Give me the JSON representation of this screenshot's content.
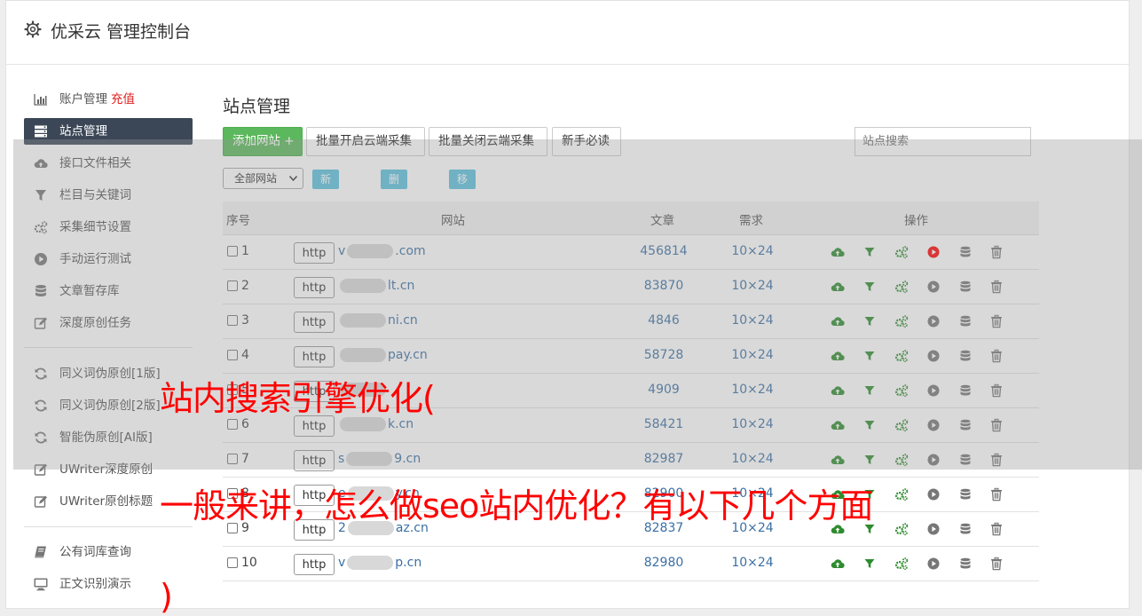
{
  "app": {
    "title": "优采云 管理控制台"
  },
  "sidebar": {
    "items": [
      {
        "label": "账户管理",
        "extra": "充值",
        "icon": "bar-chart-icon"
      },
      {
        "label": "站点管理",
        "icon": "server-icon",
        "active": true
      },
      {
        "label": "接口文件相关",
        "icon": "cloud-upload-icon"
      },
      {
        "label": "栏目与关键词",
        "icon": "filter-icon"
      },
      {
        "label": "采集细节设置",
        "icon": "gears-icon"
      },
      {
        "label": "手动运行测试",
        "icon": "play-circle-icon"
      },
      {
        "label": "文章暂存库",
        "icon": "database-icon"
      },
      {
        "label": "深度原创任务",
        "icon": "edit-icon"
      },
      {
        "label": "同义词伪原创[1版]",
        "icon": "refresh-icon"
      },
      {
        "label": "同义词伪原创[2版]",
        "icon": "refresh-icon"
      },
      {
        "label": "智能伪原创[AI版]",
        "icon": "refresh-icon"
      },
      {
        "label": "UWriter深度原创",
        "icon": "edit-icon"
      },
      {
        "label": "UWriter原创标题",
        "icon": "edit-icon"
      },
      {
        "label": "公有词库查询",
        "icon": "book-icon"
      },
      {
        "label": "正文识别演示",
        "icon": "monitor-icon"
      }
    ]
  },
  "main": {
    "title": "站点管理",
    "toolbar": {
      "add_site": "添加网站 +",
      "batch_open": "批量开启云端采集",
      "batch_close": "批量关闭云端采集",
      "guide": "新手必读",
      "search_placeholder": "站点搜索"
    },
    "group_bar": {
      "select_value": "全部网站",
      "new_group": "新建分组",
      "delete_group": "删除分组",
      "move_group": "移动分组"
    },
    "table": {
      "headers": {
        "index": "序号",
        "site": "网站",
        "articles": "文章",
        "demand": "需求",
        "actions": "操作"
      },
      "rows": [
        {
          "index": "1",
          "protocol": "http",
          "site_prefix": "v",
          "site_suffix": ".com",
          "articles": "456814",
          "demand": "10×24",
          "running": true
        },
        {
          "index": "2",
          "protocol": "http",
          "site_prefix": "",
          "site_suffix": "lt.cn",
          "articles": "83870",
          "demand": "10×24",
          "running": false
        },
        {
          "index": "3",
          "protocol": "http",
          "site_prefix": "",
          "site_suffix": "ni.cn",
          "articles": "4846",
          "demand": "10×24",
          "running": false
        },
        {
          "index": "4",
          "protocol": "http",
          "site_prefix": "",
          "site_suffix": "pay.cn",
          "articles": "58728",
          "demand": "10×24",
          "running": false
        },
        {
          "index": "5",
          "protocol": "http",
          "site_prefix": "",
          "site_suffix": "",
          "articles": "4909",
          "demand": "10×24",
          "running": false
        },
        {
          "index": "6",
          "protocol": "http",
          "site_prefix": "",
          "site_suffix": "k.cn",
          "articles": "58421",
          "demand": "10×24",
          "running": false
        },
        {
          "index": "7",
          "protocol": "http",
          "site_prefix": "s",
          "site_suffix": "9.cn",
          "articles": "82987",
          "demand": "10×24",
          "running": false
        },
        {
          "index": "8",
          "protocol": "http",
          "site_prefix": "e",
          "site_suffix": "y.cn",
          "articles": "82900",
          "demand": "10×24",
          "running": false
        },
        {
          "index": "9",
          "protocol": "http",
          "site_prefix": "2",
          "site_suffix": "az.cn",
          "articles": "82837",
          "demand": "10×24",
          "running": false
        },
        {
          "index": "10",
          "protocol": "http",
          "site_prefix": "v",
          "site_suffix": "p.cn",
          "articles": "82980",
          "demand": "10×24",
          "running": false
        }
      ]
    }
  },
  "overlay": {
    "caption_line1": "站内搜索引擎优化(",
    "caption_line2": "一般来讲，怎么做seo站内优化？有以下几个方面",
    "caption_line3": ")"
  },
  "colors": {
    "accent_green": "#5cb85c",
    "info_blue": "#5bc0de",
    "active_nav": "#3b4757",
    "caption_red": "#ff0000",
    "link_blue": "#3a6fa3"
  }
}
